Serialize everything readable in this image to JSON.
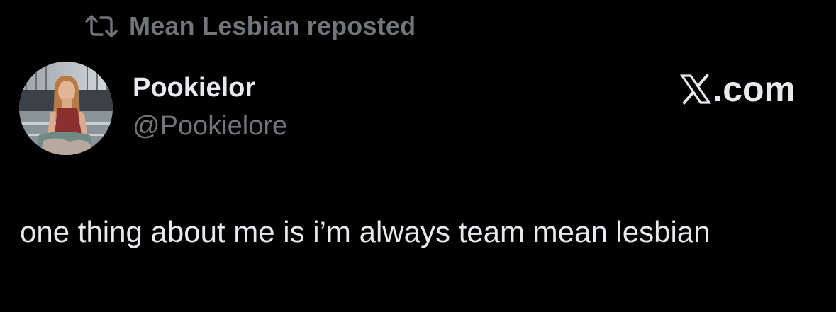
{
  "repost": {
    "icon": "repost-icon",
    "text": "Mean Lesbian reposted"
  },
  "author": {
    "avatar_icon": "profile-photo",
    "display_name": "Pookielor",
    "handle": "@Pookielore"
  },
  "brand": {
    "icon": "x-logo-icon",
    "text": ".com"
  },
  "tweet": {
    "text": "one thing about me is i’m always team mean lesbian"
  },
  "colors": {
    "background": "#000000",
    "primary_text": "#e7e9ea",
    "secondary_text": "#71767b"
  }
}
